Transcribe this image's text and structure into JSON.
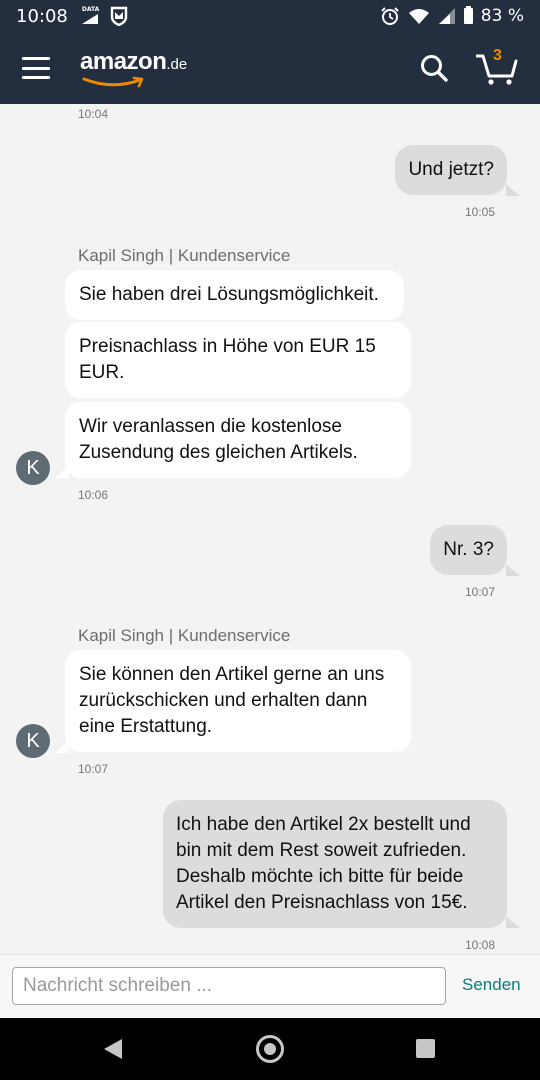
{
  "status_bar": {
    "time": "10:08",
    "data_label": "DATA",
    "battery": "83 %"
  },
  "app_bar": {
    "logo_text": "amazon",
    "logo_tld": ".de",
    "cart_count": "3"
  },
  "chat": {
    "timestamps": [
      "10:04",
      "10:05",
      "10:06",
      "10:07",
      "10:07",
      "10:08"
    ],
    "outgoing": [
      "Und jetzt?",
      "Nr. 3?",
      "Ich habe den Artikel 2x bestellt und bin mit dem Rest soweit zufrieden. Deshalb möchte ich bitte für beide Artikel den Preisnachlass von 15€."
    ],
    "agent_name": "Kapil Singh | Kundenservice",
    "avatar_initial": "K",
    "incoming": [
      "Sie haben drei Lösungsmöglichkeit.",
      "Preisnachlass in Höhe von EUR 15 EUR.",
      "Wir veranlassen die kostenlose Zusendung des gleichen Artikels.",
      "Sie können den Artikel gerne an uns zurückschicken und erhalten dann eine Erstattung."
    ]
  },
  "composer": {
    "placeholder": "Nachricht schreiben ...",
    "send_label": "Senden"
  },
  "colors": {
    "header": "#232f3e",
    "accent": "#f08804",
    "send": "#0a7c7c",
    "outgoing_bubble": "#dcdcdc",
    "incoming_bubble": "#ffffff"
  }
}
